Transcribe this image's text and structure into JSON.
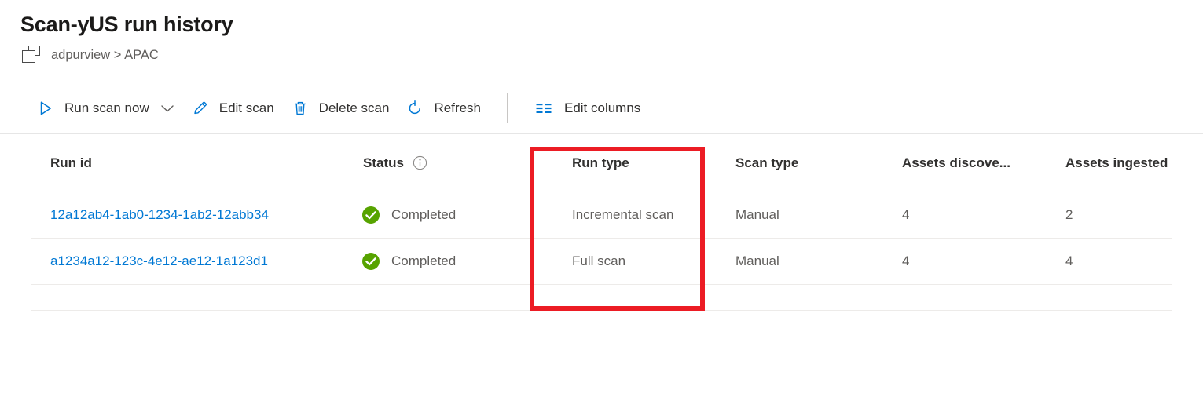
{
  "header": {
    "title": "Scan-yUS run history",
    "breadcrumb_icon": "collection-icon",
    "breadcrumb": "adpurview > APAC"
  },
  "toolbar": {
    "items": [
      {
        "label": "Run scan now",
        "icon": "play-icon",
        "has_chevron": true
      },
      {
        "label": "Edit scan",
        "icon": "pencil-icon",
        "has_chevron": false
      },
      {
        "label": "Delete scan",
        "icon": "trash-icon",
        "has_chevron": false
      },
      {
        "label": "Refresh",
        "icon": "refresh-icon",
        "has_chevron": false
      },
      {
        "label": "Edit columns",
        "icon": "edit-columns-icon",
        "has_chevron": false
      }
    ]
  },
  "table": {
    "columns": [
      {
        "label": "Run id",
        "info": false
      },
      {
        "label": "Status",
        "info": true,
        "info_icon": "info-icon"
      },
      {
        "label": "Run type",
        "info": false
      },
      {
        "label": "Scan type",
        "info": false
      },
      {
        "label": "Assets discove...",
        "info": false
      },
      {
        "label": "Assets ingested",
        "info": false
      }
    ],
    "rows": [
      {
        "run_id": "12a12ab4-1ab0-1234-1ab2-12abb34",
        "status": "Completed",
        "status_icon": "check-circle-icon",
        "run_type": "Incremental scan",
        "scan_type": "Manual",
        "assets_discovered": "4",
        "assets_ingested": "2"
      },
      {
        "run_id": "a1234a12-123c-4e12-ae12-1a123d1",
        "status": "Completed",
        "status_icon": "check-circle-icon",
        "run_type": "Full scan",
        "scan_type": "Manual",
        "assets_discovered": "4",
        "assets_ingested": "4"
      }
    ]
  },
  "annotation": {
    "highlight_color": "#ec1c24",
    "highlights_column": "Run type"
  },
  "colors": {
    "accent_blue": "#0078d4",
    "link_blue": "#0078d4",
    "success_green": "#57a300",
    "text_primary": "#323130",
    "text_secondary": "#605e5c"
  }
}
